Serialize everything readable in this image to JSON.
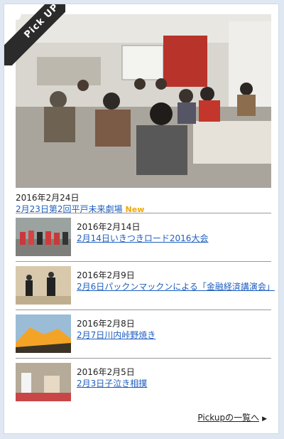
{
  "badge": {
    "label": "Pick UP",
    "icon": "bird-icon"
  },
  "featured": {
    "date": "2016年2月24日",
    "title": "2月23日第2回平戸未来劇場",
    "badge": "New"
  },
  "items": [
    {
      "date": "2016年2月14日",
      "title": "2月14日いきつきロード2016大会"
    },
    {
      "date": "2016年2月9日",
      "title": "2月6日パックンマックンによる「金融経済講演会」"
    },
    {
      "date": "2016年2月8日",
      "title": "2月7日川内峠野焼き"
    },
    {
      "date": "2016年2月5日",
      "title": "2月3日子泣き相撲"
    }
  ],
  "more": {
    "label": "Pickupの一覧へ",
    "arrow": "▶"
  },
  "colors": {
    "link": "#1e5fbf",
    "new": "#f0a800",
    "ribbon": "#2b2b2b"
  }
}
